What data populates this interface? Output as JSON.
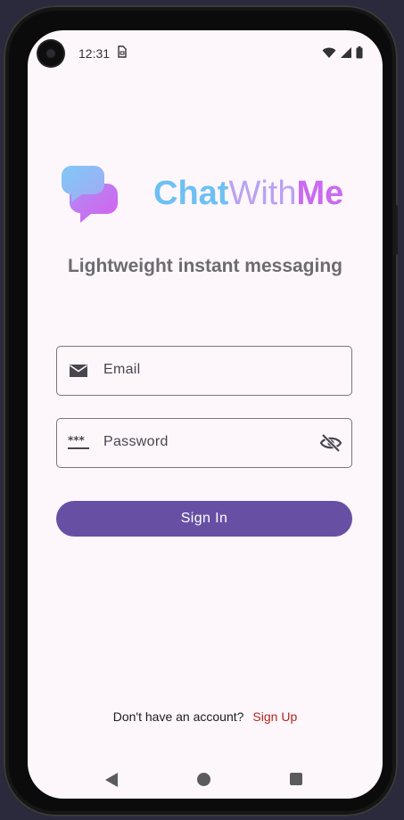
{
  "status_bar": {
    "time": "12:31",
    "sim_icon": "sim-card-icon",
    "icons": [
      "wifi-icon",
      "signal-icon",
      "battery-icon"
    ]
  },
  "logo": {
    "part1": "Chat",
    "part2": "With",
    "part3": "Me",
    "icon": "chat-bubbles-logo-icon",
    "colors": {
      "start": "#6ec0f3",
      "end": "#c96bf0"
    }
  },
  "tagline": "Lightweight instant messaging",
  "email_field": {
    "label": "Email",
    "icon": "mail-icon"
  },
  "password_field": {
    "label": "Password",
    "icon": "password-dots-icon",
    "trailing_icon": "visibility-off-icon"
  },
  "signin_button": {
    "label": "Sign In",
    "color": "#6750a4"
  },
  "footer": {
    "question": "Don't have an account?",
    "link": "Sign Up",
    "link_color": "#b3261e"
  },
  "nav": {
    "back": "back-icon",
    "home": "home-icon",
    "recents": "recents-icon"
  }
}
